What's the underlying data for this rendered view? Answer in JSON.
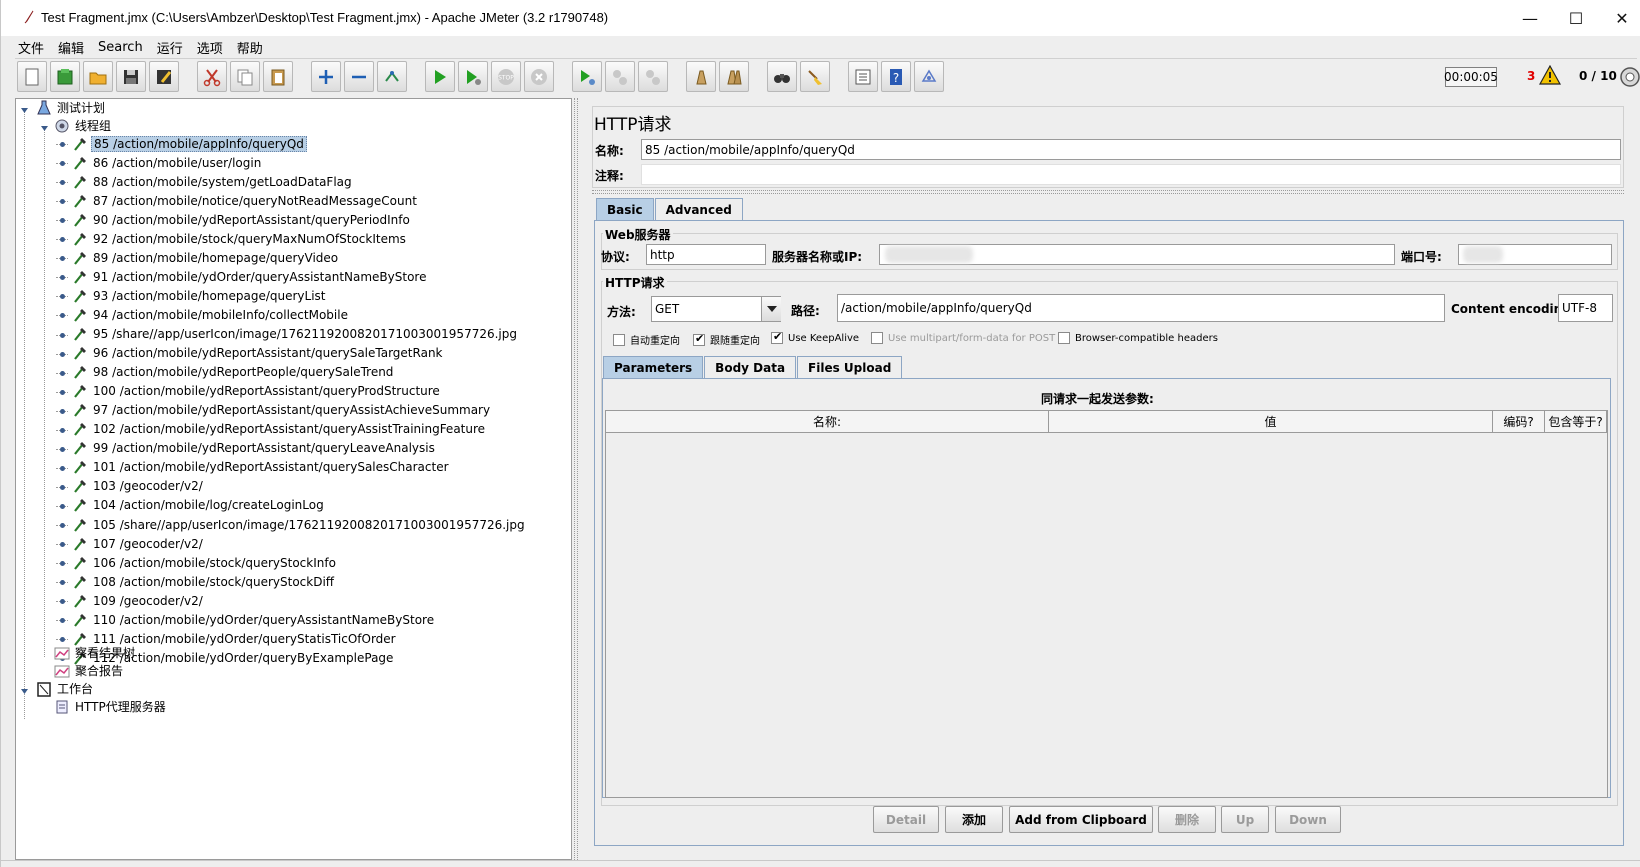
{
  "window": {
    "title": "Test Fragment.jmx (C:\\Users\\Ambzer\\Desktop\\Test Fragment.jmx) - Apache JMeter (3.2 r1790748)",
    "minimize": "—",
    "maximize": "☐",
    "close": "✕"
  },
  "menu": [
    "文件",
    "编辑",
    "Search",
    "运行",
    "选项",
    "帮助"
  ],
  "toolbar": {
    "buttons": [
      "new-icon",
      "templates-icon",
      "open-icon",
      "save-icon",
      "save-as-icon",
      "cut-icon",
      "copy-icon",
      "paste-icon",
      "expand-icon",
      "collapse-icon",
      "toggle-icon",
      "start-icon",
      "start-no-pause-icon",
      "stop-icon",
      "shutdown-icon",
      "remote-start-icon",
      "remote-stop-icon",
      "remote-shutdown-icon",
      "clear-icon",
      "clear-all-icon",
      "search-icon",
      "reset-search-icon",
      "function-helper-icon",
      "help-icon",
      "logger-icon"
    ],
    "timer": "00:00:05",
    "errors": "3",
    "threads": "0 / 10"
  },
  "tree": {
    "root": "测试计划",
    "thread_group": "线程组",
    "samplers": [
      "85 /action/mobile/appInfo/queryQd",
      "86 /action/mobile/user/login",
      "88 /action/mobile/system/getLoadDataFlag",
      "87 /action/mobile/notice/queryNotReadMessageCount",
      "90 /action/mobile/ydReportAssistant/queryPeriodInfo",
      "92 /action/mobile/stock/queryMaxNumOfStockItems",
      "89 /action/mobile/homepage/queryVideo",
      "91 /action/mobile/ydOrder/queryAssistantNameByStore",
      "93 /action/mobile/homepage/queryList",
      "94 /action/mobile/mobileInfo/collectMobile",
      "95 /share//app/userIcon/image/17621192008201710030019577​26.jpg",
      "96 /action/mobile/ydReportAssistant/querySaleTargetRank",
      "98 /action/mobile/ydReportPeople/querySaleTrend",
      "100 /action/mobile/ydReportAssistant/queryProdStructure",
      "97 /action/mobile/ydReportAssistant/queryAssistAchieveSummary",
      "102 /action/mobile/ydReportAssistant/queryAssistTrainingFeature",
      "99 /action/mobile/ydReportAssistant/queryLeaveAnalysis",
      "101 /action/mobile/ydReportAssistant/querySalesCharacter",
      "103 /geocoder/v2/",
      "104 /action/mobile/log/createLoginLog",
      "105 /share//app/userIcon/image/17621192008201710030019577​26.jpg",
      "107 /geocoder/v2/",
      "106 /action/mobile/stock/queryStockInfo",
      "108 /action/mobile/stock/queryStockDiff",
      "109 /geocoder/v2/",
      "110 /action/mobile/ydOrder/queryAssistantNameByStore",
      "111 /action/mobile/ydOrder/queryStatisTicOfOrder",
      "112 /action/mobile/ydOrder/queryByExamplePage"
    ],
    "listeners": [
      "察看结果树",
      "聚合报告"
    ],
    "workbench": "工作台",
    "proxy": "HTTP代理服务器"
  },
  "sampler": {
    "heading": "HTTP请求",
    "name_label": "名称:",
    "name_value": "85 /action/mobile/appInfo/queryQd",
    "comment_label": "注释:",
    "tabs": [
      "Basic",
      "Advanced"
    ],
    "web_server": {
      "title": "Web服务器",
      "protocol_label": "协议:",
      "protocol_value": "http",
      "server_label": "服务器名称或IP:",
      "port_label": "端口号:"
    },
    "http_request": {
      "title": "HTTP请求",
      "method_label": "方法:",
      "method_value": "GET",
      "path_label": "路径:",
      "path_value": "/action/mobile/appInfo/queryQd",
      "encoding_label": "Content encoding:",
      "encoding_value": "UTF-8"
    },
    "options": [
      {
        "label": "自动重定向",
        "checked": false,
        "disabled": false
      },
      {
        "label": "跟随重定向",
        "checked": true,
        "disabled": false
      },
      {
        "label": "Use KeepAlive",
        "checked": true,
        "disabled": false
      },
      {
        "label": "Use multipart/form-data for POST",
        "checked": false,
        "disabled": true
      },
      {
        "label": "Browser-compatible headers",
        "checked": false,
        "disabled": false
      }
    ],
    "sub_tabs": [
      "Parameters",
      "Body Data",
      "Files Upload"
    ],
    "params_caption": "同请求一起发送参数:",
    "columns": [
      "名称:",
      "值",
      "编码?",
      "包含等于?"
    ],
    "buttons": {
      "detail": "Detail",
      "add": "添加",
      "add_clipboard": "Add from Clipboard",
      "delete": "删除",
      "up": "Up",
      "down": "Down"
    }
  }
}
